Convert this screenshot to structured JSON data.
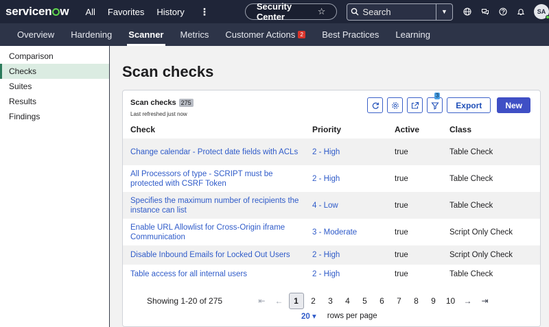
{
  "topbar": {
    "logo": "servicenow",
    "nav": [
      "All",
      "Favorites",
      "History"
    ],
    "more": "⋮",
    "context_pill": "Security Center",
    "search_label": "Search",
    "avatar": "SA"
  },
  "subnav": {
    "tabs": [
      "Overview",
      "Hardening",
      "Scanner",
      "Metrics",
      "Customer Actions",
      "Best Practices",
      "Learning"
    ],
    "active_tab": "Scanner",
    "customer_actions_badge": "2"
  },
  "sidebar": {
    "items": [
      "Comparison",
      "Checks",
      "Suites",
      "Results",
      "Findings"
    ],
    "active": "Checks"
  },
  "main": {
    "title": "Scan checks",
    "card": {
      "title": "Scan checks",
      "count": "275",
      "refreshed": "Last refreshed just now",
      "filter_badge": "3",
      "export_label": "Export",
      "new_label": "New",
      "columns": [
        "Check",
        "Priority",
        "Active",
        "Class"
      ],
      "rows": [
        {
          "check": "Change calendar - Protect date fields with ACLs",
          "priority": "2 - High",
          "active": "true",
          "class": "Table Check"
        },
        {
          "check": "All Processors of type - SCRIPT must be protected with CSRF Token",
          "priority": "2 - High",
          "active": "true",
          "class": "Table Check"
        },
        {
          "check": "Specifies the maximum number of recipients the instance can list",
          "priority": "4 - Low",
          "active": "true",
          "class": "Table Check"
        },
        {
          "check": "Enable URL Allowlist for Cross-Origin iframe Communication",
          "priority": "3 - Moderate",
          "active": "true",
          "class": "Script Only Check"
        },
        {
          "check": "Disable Inbound Emails for Locked Out Users",
          "priority": "2 - High",
          "active": "true",
          "class": "Script Only Check"
        },
        {
          "check": "Table access for all internal users",
          "priority": "2 - High",
          "active": "true",
          "class": "Table Check"
        }
      ],
      "pagination": {
        "showing": "Showing 1-20 of 275",
        "pages": [
          "1",
          "2",
          "3",
          "4",
          "5",
          "6",
          "7",
          "8",
          "9",
          "10"
        ],
        "current_page": "1",
        "rows_per_page": "20",
        "rows_per_page_label": "rows per page"
      }
    }
  },
  "colors": {
    "topbar_bg": "#1f2538",
    "subnav_bg": "#2d3448",
    "link": "#2f5bc9",
    "primary_button": "#3f4fc5",
    "sidebar_active_bg": "#dbece2",
    "badge_red": "#d9342b"
  }
}
